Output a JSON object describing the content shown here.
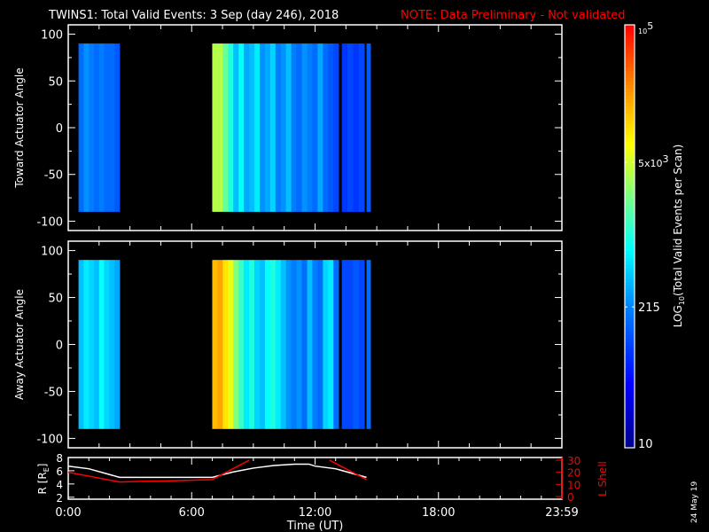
{
  "title": "TWINS1: Total Valid Events:  3 Sep (day 246), 2018",
  "note": "NOTE: Data Preliminary - Not validated",
  "stamp": "24 May 19",
  "chart_data": [
    {
      "type": "heatmap",
      "ylabel": "Toward Actuator Angle",
      "yticks": [
        "100",
        "50",
        "0",
        "-50",
        "-100"
      ],
      "ylim": [
        -110,
        110
      ],
      "y_data_range": [
        -90,
        90
      ],
      "xlim_hours": [
        0,
        24
      ],
      "value_scale": "log10 counts",
      "segments": [
        {
          "start": 0.5,
          "end": 2.5,
          "values": [
            2.2,
            2.4,
            2.3,
            2.2,
            2.3,
            2.2,
            2.2,
            2.1
          ]
        },
        {
          "start": 7.0,
          "end": 13.15,
          "values": [
            3.6,
            3.6,
            3.3,
            3.0,
            2.6,
            2.9,
            2.5,
            2.6,
            2.8,
            2.4,
            2.5,
            2.7,
            2.3,
            2.4,
            2.6,
            2.3,
            2.2,
            2.4,
            2.3,
            2.2,
            2.5,
            2.2,
            2.1,
            2.0
          ]
        },
        {
          "start": 13.3,
          "end": 14.4,
          "values": [
            1.9,
            2.0,
            1.9,
            2.0
          ]
        },
        {
          "start": 14.5,
          "end": 14.7,
          "values": [
            2.1
          ]
        }
      ]
    },
    {
      "type": "heatmap",
      "ylabel": "Away Actuator Angle",
      "yticks": [
        "100",
        "50",
        "0",
        "-50",
        "-100"
      ],
      "ylim": [
        -110,
        110
      ],
      "y_data_range": [
        -90,
        90
      ],
      "xlim_hours": [
        0,
        24
      ],
      "value_scale": "log10 counts",
      "segments": [
        {
          "start": 0.5,
          "end": 2.5,
          "values": [
            2.6,
            2.8,
            2.7,
            2.6,
            2.9,
            2.7,
            2.6,
            2.5
          ]
        },
        {
          "start": 7.0,
          "end": 13.15,
          "values": [
            4.2,
            4.3,
            4.0,
            3.8,
            3.4,
            3.1,
            2.8,
            3.0,
            2.7,
            2.6,
            2.9,
            3.0,
            2.8,
            2.6,
            2.4,
            2.3,
            2.4,
            2.2,
            2.6,
            2.3,
            2.2,
            2.7,
            2.8,
            2.2
          ]
        },
        {
          "start": 13.3,
          "end": 14.4,
          "values": [
            2.0,
            2.0,
            2.1,
            2.0
          ]
        },
        {
          "start": 14.5,
          "end": 14.7,
          "values": [
            2.2
          ]
        }
      ]
    },
    {
      "type": "line",
      "ylabel": "R [R",
      "ylabel_sub": "E",
      "ylabel_close": "]",
      "y2label": "L Shell",
      "xlabel": "Time (UT)",
      "xticks": [
        "0:00",
        "6:00",
        "12:00",
        "18:00",
        "23:59"
      ],
      "yticks": [
        "2",
        "4",
        "6",
        "8"
      ],
      "y2ticks": [
        "0",
        "10",
        "20",
        "30"
      ],
      "ylim": [
        1.7,
        8
      ],
      "y2lim": [
        0,
        30
      ],
      "series": [
        {
          "name": "R",
          "color": "#ffffff",
          "x": [
            0,
            1,
            2.5,
            7,
            8,
            9,
            10,
            11,
            11.7,
            12,
            13,
            14.5
          ],
          "y": [
            6.7,
            6.3,
            5.0,
            5.0,
            5.8,
            6.4,
            6.8,
            7.0,
            7.0,
            6.7,
            6.3,
            5.0
          ]
        },
        {
          "name": "L Shell",
          "color": "#ff0000",
          "axis": "y2",
          "x": [
            0,
            2.5,
            3.5,
            5,
            7,
            8.8
          ],
          "y": [
            20,
            12,
            12.5,
            13,
            14,
            30
          ]
        },
        {
          "name": "L Shell (post)",
          "color": "#ff0000",
          "axis": "y2",
          "x": [
            12.7,
            14.5
          ],
          "y": [
            30,
            14
          ]
        }
      ]
    },
    {
      "type": "colorbar",
      "label": "LOG",
      "label_sub": "10",
      "label_rest": "(Total Valid Events per Scan)",
      "ticks": [
        {
          "value": 5,
          "base": "10",
          "exp": "5"
        },
        {
          "value": 3.699,
          "base": "5x10",
          "exp": "3"
        },
        {
          "value": 2.332,
          "text": "215"
        },
        {
          "value": 1,
          "text": "10"
        }
      ],
      "range": [
        1,
        5
      ]
    }
  ]
}
